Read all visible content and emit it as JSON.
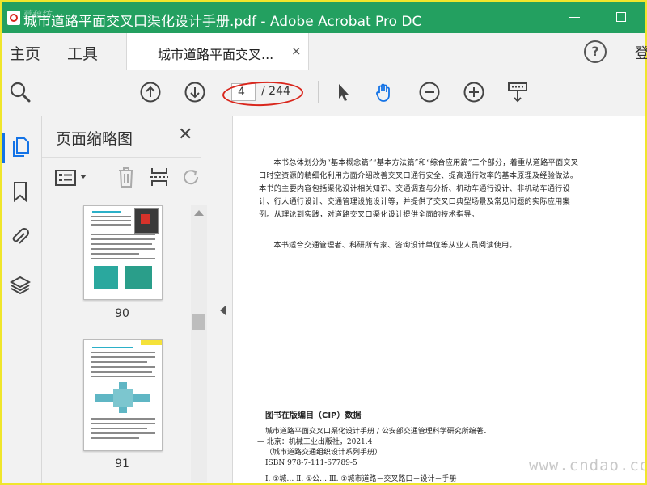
{
  "window": {
    "title": "城市道路平面交叉口渠化设计手册.pdf - Adobe Acrobat Pro DC",
    "watermark_corner": "草稿坊"
  },
  "tabs": {
    "home": "主页",
    "tools": "工具",
    "document": "城市道路平面交叉...",
    "close_symbol": "×",
    "help_symbol": "?",
    "signin": "登录"
  },
  "toolbar": {
    "current_page": "4",
    "total_pages": "/ 244"
  },
  "panel": {
    "title": "页面缩略图",
    "close_symbol": "✕",
    "thumbnails": [
      {
        "page": "90"
      },
      {
        "page": "91"
      }
    ]
  },
  "document": {
    "paragraph1": "本书总体划分为“基本概念篇”“基本方法篇”和“综合应用篇”三个部分，着重从道路平面交叉口时空资源的精细化利用方面介绍改善交叉口通行安全、提高通行效率的基本原理及经验做法。本书的主要内容包括渠化设计相关知识、交通调查与分析、机动车通行设计、非机动车通行设计、行人通行设计、交通管理设施设计等，并提供了交叉口典型场景及常见问题的实际应用案例。从理论到实践，对道路交叉口渠化设计提供全面的技术指导。",
    "paragraph2": "本书适合交通管理者、科研所专家、咨询设计单位等从业人员阅读使用。",
    "cip_title": "图书在版编目（CIP）数据",
    "cip_lines": [
      "城市道路平面交叉口渠化设计手册 / 公安部交通管理科学研究所编著．",
      "— 北京：机械工业出版社，2021.4",
      "（城市道路交通组织设计系列手册）",
      "ISBN 978-7-111-67789-5",
      "Ⅰ. ①城…  Ⅱ. ①公…  Ⅲ. ①城市道路－交叉路口－设计－手册"
    ],
    "site_watermark": "www.cndao.com"
  },
  "colors": {
    "titlebar": "#23a060",
    "border_highlight": "#f0e62c",
    "annotation_red": "#d9261c",
    "accent_blue": "#1473e6"
  }
}
